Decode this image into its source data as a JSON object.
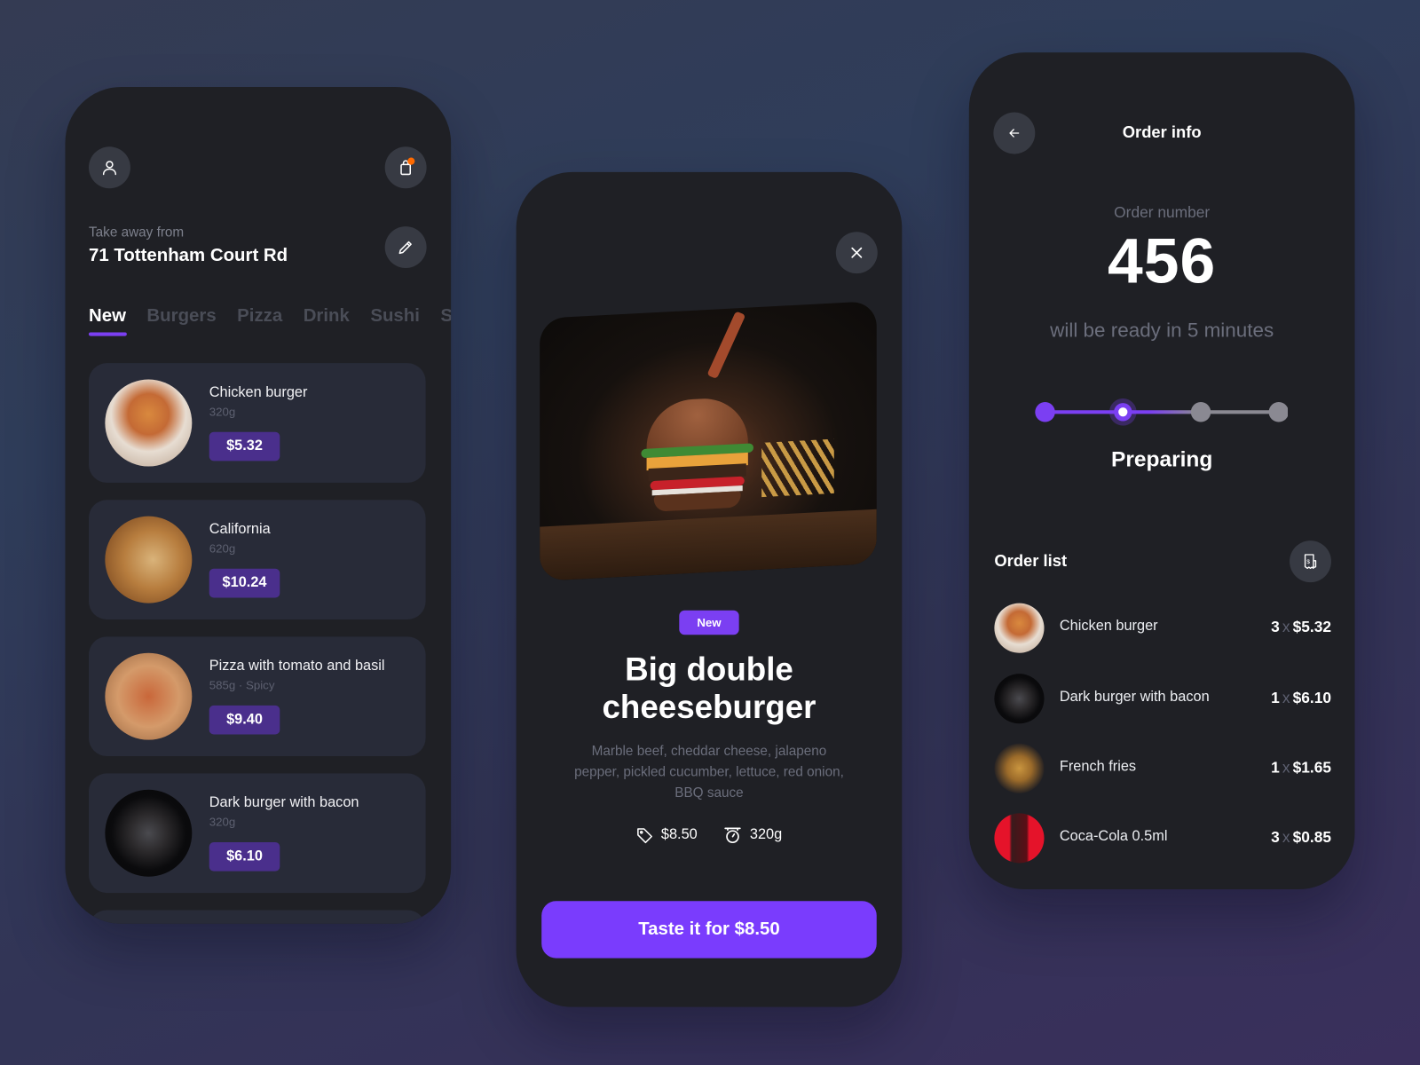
{
  "colors": {
    "accent": "#7b3ff2",
    "card_bg": "#1f2025",
    "notification": "#ff6a00"
  },
  "menu_screen": {
    "icons": {
      "profile": "user-icon",
      "cart": "shopping-bag-icon",
      "edit": "pencil-icon"
    },
    "location_label": "Take away from",
    "location_value": "71 Tottenham Court Rd",
    "tabs": [
      {
        "label": "New",
        "active": true
      },
      {
        "label": "Burgers",
        "active": false
      },
      {
        "label": "Pizza",
        "active": false
      },
      {
        "label": "Drink",
        "active": false
      },
      {
        "label": "Sushi",
        "active": false
      },
      {
        "label": "Se",
        "active": false
      }
    ],
    "items": [
      {
        "name": "Chicken burger",
        "meta": "320g",
        "price": "$5.32"
      },
      {
        "name": "California",
        "meta": "620g",
        "price": "$10.24"
      },
      {
        "name": "Pizza with tomato and basil",
        "meta": "585g  ·  Spicy",
        "price": "$9.40"
      },
      {
        "name": "Dark burger with bacon",
        "meta": "320g",
        "price": "$6.10"
      }
    ]
  },
  "detail_screen": {
    "badge": "New",
    "title_line1": "Big double",
    "title_line2": "cheeseburger",
    "description": "Marble beef, cheddar cheese, jalapeno pepper, pickled cucumber, lettuce, red onion, BBQ sauce",
    "price": "$8.50",
    "weight": "320g",
    "cta_label": "Taste it for $8.50"
  },
  "order_screen": {
    "title": "Order info",
    "order_number_label": "Order number",
    "order_number": "456",
    "ready_text": "will be ready in 5 minutes",
    "progress": {
      "steps": 4,
      "current_step": 2,
      "status_label": "Preparing"
    },
    "order_list_title": "Order list",
    "items": [
      {
        "name": "Chicken burger",
        "qty": "3",
        "x": "x",
        "price": "$5.32"
      },
      {
        "name": "Dark burger with bacon",
        "qty": "1",
        "x": "x",
        "price": "$6.10"
      },
      {
        "name": "French fries",
        "qty": "1",
        "x": "x",
        "price": "$1.65"
      },
      {
        "name": "Coca-Cola 0.5ml",
        "qty": "3",
        "x": "x",
        "price": "$0.85"
      }
    ]
  }
}
